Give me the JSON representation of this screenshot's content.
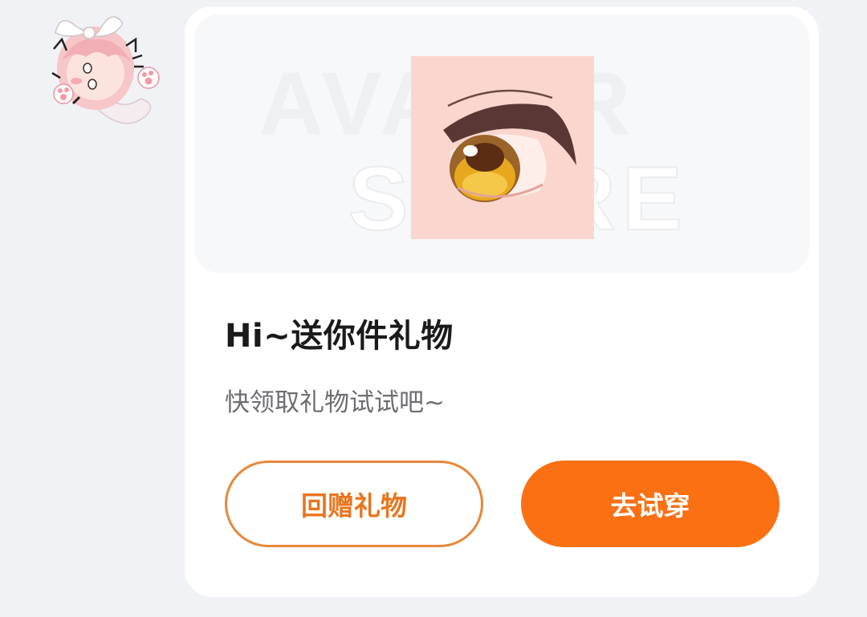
{
  "sender": {
    "sticker_icon": "cat-girl-sticker-icon"
  },
  "gift_card": {
    "banner": {
      "watermark_line1": "AVATAR",
      "watermark_line2": "STORE",
      "item_icon": "anime-eye-icon",
      "item_bg_color": "#fbd6cf"
    },
    "title": "Hi~送你件礼物",
    "subtitle": "快领取礼物试试吧~",
    "buttons": {
      "return_gift_label": "回赠礼物",
      "try_on_label": "去试穿"
    },
    "colors": {
      "accent": "#fa7013",
      "outline": "#e8883a",
      "card_bg": "#ffffff",
      "page_bg": "#f1f2f5"
    }
  }
}
